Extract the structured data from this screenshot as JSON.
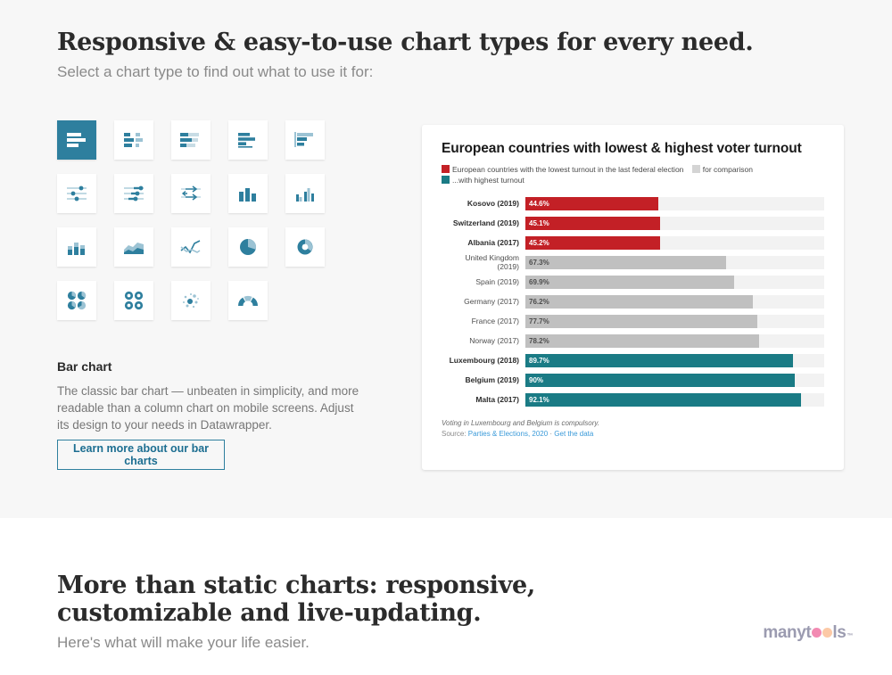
{
  "header": {
    "title": "Responsive & easy-to-use chart types for every need.",
    "subtitle": "Select a chart type to find out what to use it for:"
  },
  "icon_grid": {
    "active_index": 0,
    "items": [
      {
        "name": "bar-chart-icon",
        "label": "Bar chart"
      },
      {
        "name": "split-bars-icon",
        "label": "Split bars"
      },
      {
        "name": "stacked-bars-icon",
        "label": "Stacked bars"
      },
      {
        "name": "bullet-bars-icon",
        "label": "Bullet bars"
      },
      {
        "name": "grouped-bars-icon",
        "label": "Grouped bars"
      },
      {
        "name": "dot-plot-icon",
        "label": "Dot plot"
      },
      {
        "name": "range-plot-icon",
        "label": "Range plot"
      },
      {
        "name": "arrow-plot-icon",
        "label": "Arrow plot"
      },
      {
        "name": "column-chart-icon",
        "label": "Column chart"
      },
      {
        "name": "grouped-column-icon",
        "label": "Grouped column chart"
      },
      {
        "name": "stacked-column-icon",
        "label": "Stacked column chart"
      },
      {
        "name": "area-chart-icon",
        "label": "Area chart"
      },
      {
        "name": "line-chart-icon",
        "label": "Line chart"
      },
      {
        "name": "pie-chart-icon",
        "label": "Pie chart"
      },
      {
        "name": "donut-chart-icon",
        "label": "Donut chart"
      },
      {
        "name": "multiple-pies-icon",
        "label": "Multiple pies"
      },
      {
        "name": "multiple-donuts-icon",
        "label": "Multiple donuts"
      },
      {
        "name": "scatter-plot-icon",
        "label": "Scatter plot"
      },
      {
        "name": "arc-gauge-icon",
        "label": "Arrow / gauge chart"
      }
    ]
  },
  "description": {
    "title": "Bar chart",
    "body": "The classic bar chart — unbeaten in simplicity, and more readable than a column chart on mobile screens. Adjust its design to your needs in Datawrapper.",
    "button_label": "Learn more about our bar charts"
  },
  "colors": {
    "accent": "#2e7f9e",
    "lowest": "#c32026",
    "comparison": "#c0c0c0",
    "highest": "#1a7b85",
    "track": "#f2f2f2",
    "link": "#3a9ad9",
    "page_bg": "#f7f7f7"
  },
  "chart_data": {
    "type": "bar",
    "title": "European countries with lowest & highest voter turnout",
    "xlabel": "",
    "ylabel": "",
    "xlim": [
      0,
      100
    ],
    "grid": false,
    "legend_position": "top",
    "legend": [
      {
        "label": "European countries with the lowest turnout in the last federal election",
        "color": "#c32026",
        "key": "red"
      },
      {
        "label": "for comparison",
        "color": "#c0c0c0",
        "key": "gray"
      },
      {
        "label": "...with highest turnout",
        "color": "#1a7b85",
        "key": "teal"
      }
    ],
    "categories": [
      "Kosovo (2019)",
      "Switzerland (2019)",
      "Albania (2017)",
      "United Kingdom (2019)",
      "Spain (2019)",
      "Germany (2017)",
      "France (2017)",
      "Norway (2017)",
      "Luxembourg (2018)",
      "Belgium (2019)",
      "Malta (2017)"
    ],
    "values": [
      44.6,
      45.1,
      45.2,
      67.3,
      69.9,
      76.2,
      77.7,
      78.2,
      89.7,
      90,
      92.1
    ],
    "value_labels": [
      "44.6%",
      "45.1%",
      "45.2%",
      "67.3%",
      "69.9%",
      "76.2%",
      "77.7%",
      "78.2%",
      "89.7%",
      "90%",
      "92.1%"
    ],
    "groups": [
      "red",
      "red",
      "red",
      "gray",
      "gray",
      "gray",
      "gray",
      "gray",
      "teal",
      "teal",
      "teal"
    ],
    "rows": [
      {
        "label": "Kosovo (2019)",
        "value": 44.6,
        "value_label": "44.6%",
        "group": "red",
        "bold": true
      },
      {
        "label": "Switzerland (2019)",
        "value": 45.1,
        "value_label": "45.1%",
        "group": "red",
        "bold": true
      },
      {
        "label": "Albania (2017)",
        "value": 45.2,
        "value_label": "45.2%",
        "group": "red",
        "bold": true
      },
      {
        "label": "United Kingdom (2019)",
        "value": 67.3,
        "value_label": "67.3%",
        "group": "gray",
        "bold": false
      },
      {
        "label": "Spain (2019)",
        "value": 69.9,
        "value_label": "69.9%",
        "group": "gray",
        "bold": false
      },
      {
        "label": "Germany (2017)",
        "value": 76.2,
        "value_label": "76.2%",
        "group": "gray",
        "bold": false
      },
      {
        "label": "France (2017)",
        "value": 77.7,
        "value_label": "77.7%",
        "group": "gray",
        "bold": false
      },
      {
        "label": "Norway (2017)",
        "value": 78.2,
        "value_label": "78.2%",
        "group": "gray",
        "bold": false
      },
      {
        "label": "Luxembourg (2018)",
        "value": 89.7,
        "value_label": "89.7%",
        "group": "teal",
        "bold": true
      },
      {
        "label": "Belgium (2019)",
        "value": 90,
        "value_label": "90%",
        "group": "teal",
        "bold": true
      },
      {
        "label": "Malta (2017)",
        "value": 92.1,
        "value_label": "92.1%",
        "group": "teal",
        "bold": true
      }
    ],
    "note": "Voting in Luxembourg and Belgium is compulsory.",
    "source_prefix": "Source: ",
    "source_link": "Parties & Elections, 2020",
    "source_separator": " · ",
    "data_link": "Get the data"
  },
  "bottom": {
    "title": "More than static charts: responsive, customizable and live-updating.",
    "subtitle": "Here's what will make your life easier."
  },
  "logo": {
    "text_start": "many",
    "text_mid": "t",
    "text_end": "ls",
    "tm": "™"
  }
}
